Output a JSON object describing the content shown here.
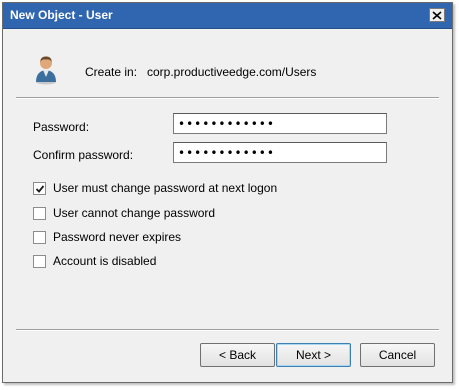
{
  "window": {
    "title": "New Object - User",
    "close_icon": "close-icon"
  },
  "header": {
    "icon": "user-icon",
    "create_in_label": "Create in:",
    "create_in_path": "corp.productiveedge.com/Users"
  },
  "form": {
    "password_label": "Password:",
    "password_value": "••••••••••••",
    "confirm_label": "Confirm password:",
    "confirm_value": "••••••••••••"
  },
  "options": [
    {
      "label": "User must change password at next logon",
      "checked": true
    },
    {
      "label": "User cannot change password",
      "checked": false
    },
    {
      "label": "Password never expires",
      "checked": false
    },
    {
      "label": "Account is disabled",
      "checked": false
    }
  ],
  "buttons": {
    "back": "< Back",
    "next": "Next >",
    "cancel": "Cancel"
  },
  "colors": {
    "titlebar": "#3066b0",
    "dialog_background": "#f0f0f0"
  }
}
